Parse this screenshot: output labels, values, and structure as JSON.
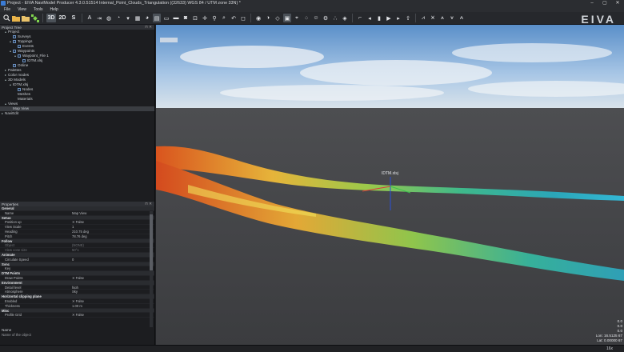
{
  "window": {
    "title": "Project - EIVA NaviModel Producer 4.3.0.51514 Internal_Point_Clouds_Triangulation ((32633) WGS 84 / UTM zone 33N) *",
    "controls": [
      "–",
      "▢",
      "✕"
    ]
  },
  "menu": [
    "File",
    "View",
    "Tools",
    "Help"
  ],
  "toolbar": {
    "view_3d": "3D",
    "view_2d": "2D",
    "view_s": "S",
    "brand": "EIVA"
  },
  "project_tree": {
    "header": "Project Tree",
    "header_buttons": "⊓ ✕",
    "items": [
      {
        "label": "Project",
        "indent": 0,
        "arrow": "▴",
        "checkbox": false
      },
      {
        "label": "Surveys",
        "indent": 1,
        "arrow": "",
        "checkbox": true
      },
      {
        "label": "Toppings",
        "indent": 1,
        "arrow": "▴",
        "checkbox": true
      },
      {
        "label": "Events",
        "indent": 2,
        "arrow": "",
        "checkbox": true
      },
      {
        "label": "Waypoints",
        "indent": 1,
        "arrow": "▴",
        "checkbox": true
      },
      {
        "label": "Waypoint_File 1",
        "indent": 2,
        "arrow": "▴",
        "checkbox": true
      },
      {
        "label": "IDTM.xlsj",
        "indent": 3,
        "arrow": "",
        "checkbox": true
      },
      {
        "label": "Online",
        "indent": 1,
        "arrow": "",
        "checkbox": true
      },
      {
        "label": "Palettes",
        "indent": 0,
        "arrow": "▸",
        "checkbox": false
      },
      {
        "label": "Color modes",
        "indent": 0,
        "arrow": "▸",
        "checkbox": false
      },
      {
        "label": "3D Models",
        "indent": 0,
        "arrow": "▴",
        "checkbox": false
      },
      {
        "label": "IDTM.xlsj",
        "indent": 1,
        "arrow": "▴",
        "checkbox": false
      },
      {
        "label": "Nodes",
        "indent": 2,
        "arrow": "",
        "checkbox": true
      },
      {
        "label": "Meshes",
        "indent": 2,
        "arrow": "",
        "checkbox": false
      },
      {
        "label": "Materials",
        "indent": 2,
        "arrow": "",
        "checkbox": false
      },
      {
        "label": "Views",
        "indent": 0,
        "arrow": "▴",
        "checkbox": false
      },
      {
        "label": "Map View",
        "indent": 1,
        "arrow": "",
        "checkbox": false,
        "selected": true
      },
      {
        "label": "NaviEdit",
        "indent": -1,
        "arrow": "▸",
        "checkbox": false
      }
    ]
  },
  "properties": {
    "header": "Properties",
    "header_buttons": "⊓ ✕",
    "rows": [
      {
        "k": "General",
        "v": "",
        "type": "group"
      },
      {
        "k": "Name",
        "v": "Map View"
      },
      {
        "k": "Setup",
        "v": "",
        "type": "group"
      },
      {
        "k": "Position up",
        "v": "✕  False"
      },
      {
        "k": "View Scale",
        "v": "1"
      },
      {
        "k": "Heading",
        "v": "210.75 deg"
      },
      {
        "k": "Pitch",
        "v": "78.76 deg"
      },
      {
        "k": "Follow",
        "v": "",
        "type": "group"
      },
      {
        "k": "Object",
        "v": "(NONE)",
        "type": "dim"
      },
      {
        "k": "View cone size",
        "v": "50°1",
        "type": "dim"
      },
      {
        "k": "Animate",
        "v": "",
        "type": "group"
      },
      {
        "k": "Circulate Speed",
        "v": "0"
      },
      {
        "k": "Sync",
        "v": "",
        "type": "group"
      },
      {
        "k": "Key",
        "v": ""
      },
      {
        "k": "DTM Points",
        "v": "",
        "type": "group"
      },
      {
        "k": "Draw Points",
        "v": "✕  False"
      },
      {
        "k": "Environment",
        "v": "",
        "type": "group"
      },
      {
        "k": "Detail level",
        "v": "high"
      },
      {
        "k": "Atmosphere",
        "v": "Sky"
      },
      {
        "k": "Horizontal clipping plane",
        "v": "",
        "type": "group"
      },
      {
        "k": "Enabled",
        "v": "✕  False"
      },
      {
        "k": "Thickness",
        "v": "1.00 m"
      },
      {
        "k": "Misc",
        "v": "",
        "type": "group"
      },
      {
        "k": "Profile Grid",
        "v": "✕  False"
      }
    ],
    "footer_name": "Name",
    "footer_desc": "Name of the object"
  },
  "viewport": {
    "label_dtm": "IDTM.xlsj",
    "readout_lines": [
      "0.0",
      "0.0",
      "0.0"
    ],
    "lon": "Lon: 16.5125 67",
    "lat": "Lat: 0.00000 67",
    "zoom": "16x"
  }
}
